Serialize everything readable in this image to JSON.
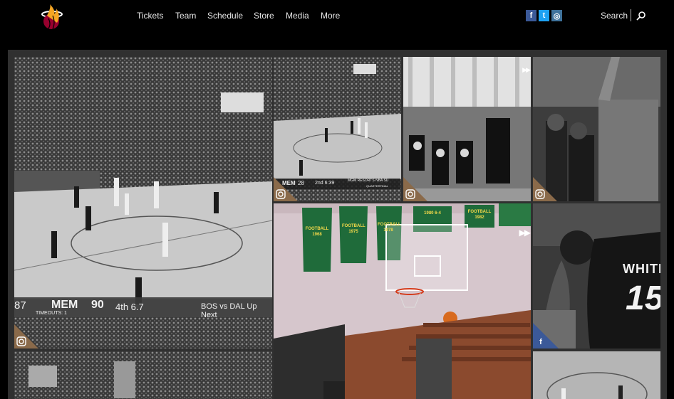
{
  "nav": {
    "items": [
      {
        "label": "Tickets"
      },
      {
        "label": "Team"
      },
      {
        "label": "Schedule"
      },
      {
        "label": "Store"
      },
      {
        "label": "Media"
      },
      {
        "label": "More"
      }
    ]
  },
  "social": {
    "facebook_glyph": "f",
    "twitter_glyph": "t",
    "instagram_glyph": "◎"
  },
  "search": {
    "label": "Search"
  },
  "tiles": {
    "arena": {
      "away_score": "87",
      "home_team": "MEM",
      "home_score": "90",
      "period_clock": "4th 6.7",
      "timeouts": "TIMEOUTS: 1",
      "up_next": "BOS vs DAL  Up Next",
      "source": "instagram"
    },
    "summer": {
      "team": "MEM",
      "score": "28",
      "clock": "2nd 6:39",
      "sponsor": "MGM RESORTS NBA SU",
      "round": "QUARTERFINAL",
      "source": "instagram"
    },
    "drill": {
      "source": "instagram"
    },
    "bench": {
      "source": "instagram"
    },
    "gym": {
      "banners": [
        "FOOTBALL 1968",
        "FOOTBALL 1975",
        "FOOTBALL 1978",
        "1980 6-4",
        "FOOTBALL 1982"
      ],
      "source": "video"
    },
    "jersey": {
      "jersey_text": "WHITE",
      "jersey_number": "15",
      "source": "facebook"
    }
  },
  "colors": {
    "brand_red": "#98002e",
    "facebook": "#3b5998",
    "twitter": "#1da1f2",
    "instagram": "#3f729b",
    "gym_banner": "#1f6b3a"
  }
}
